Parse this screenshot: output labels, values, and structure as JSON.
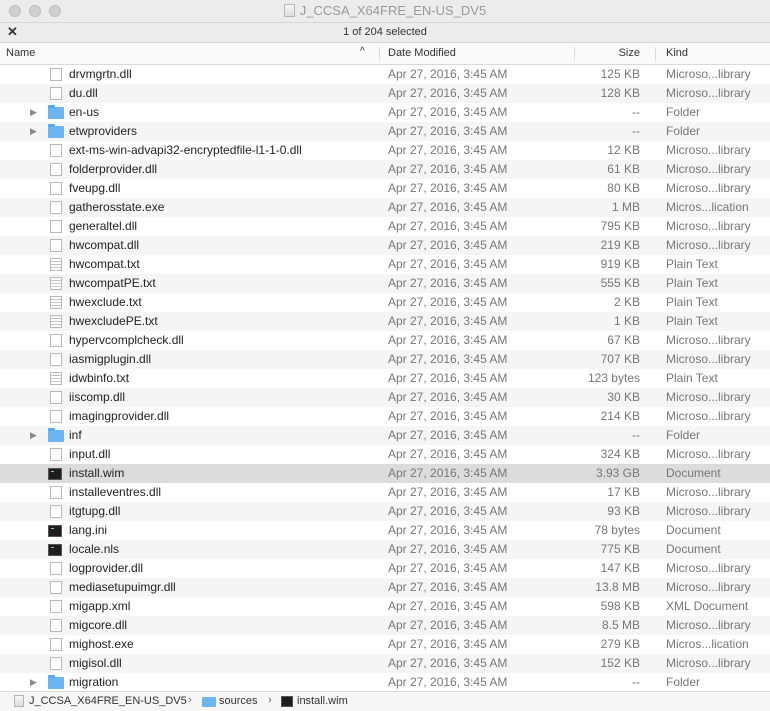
{
  "window": {
    "title": "J_CCSA_X64FRE_EN-US_DV5",
    "status": "1 of 204 selected"
  },
  "columns": {
    "name": "Name",
    "date": "Date Modified",
    "size": "Size",
    "kind": "Kind",
    "sort_indicator": "^"
  },
  "files": [
    {
      "name": "drvmgrtn.dll",
      "date": "Apr 27, 2016, 3:45 AM",
      "size": "125 KB",
      "kind": "Microso...library",
      "icon": "file-icon"
    },
    {
      "name": "du.dll",
      "date": "Apr 27, 2016, 3:45 AM",
      "size": "128 KB",
      "kind": "Microso...library",
      "icon": "file-icon"
    },
    {
      "name": "en-us",
      "date": "Apr 27, 2016, 3:45 AM",
      "size": "--",
      "kind": "Folder",
      "icon": "folder-icon"
    },
    {
      "name": "etwproviders",
      "date": "Apr 27, 2016, 3:45 AM",
      "size": "--",
      "kind": "Folder",
      "icon": "folder-icon"
    },
    {
      "name": "ext-ms-win-advapi32-encryptedfile-l1-1-0.dll",
      "date": "Apr 27, 2016, 3:45 AM",
      "size": "12 KB",
      "kind": "Microso...library",
      "icon": "file-icon"
    },
    {
      "name": "folderprovider.dll",
      "date": "Apr 27, 2016, 3:45 AM",
      "size": "61 KB",
      "kind": "Microso...library",
      "icon": "file-icon"
    },
    {
      "name": "fveupg.dll",
      "date": "Apr 27, 2016, 3:45 AM",
      "size": "80 KB",
      "kind": "Microso...library",
      "icon": "file-icon"
    },
    {
      "name": "gatherosstate.exe",
      "date": "Apr 27, 2016, 3:45 AM",
      "size": "1 MB",
      "kind": "Micros...lication",
      "icon": "file-icon"
    },
    {
      "name": "generaltel.dll",
      "date": "Apr 27, 2016, 3:45 AM",
      "size": "795 KB",
      "kind": "Microso...library",
      "icon": "file-icon"
    },
    {
      "name": "hwcompat.dll",
      "date": "Apr 27, 2016, 3:45 AM",
      "size": "219 KB",
      "kind": "Microso...library",
      "icon": "file-icon"
    },
    {
      "name": "hwcompat.txt",
      "date": "Apr 27, 2016, 3:45 AM",
      "size": "919 KB",
      "kind": "Plain Text",
      "icon": "text-file-icon"
    },
    {
      "name": "hwcompatPE.txt",
      "date": "Apr 27, 2016, 3:45 AM",
      "size": "555 KB",
      "kind": "Plain Text",
      "icon": "text-file-icon"
    },
    {
      "name": "hwexclude.txt",
      "date": "Apr 27, 2016, 3:45 AM",
      "size": "2 KB",
      "kind": "Plain Text",
      "icon": "text-file-icon"
    },
    {
      "name": "hwexcludePE.txt",
      "date": "Apr 27, 2016, 3:45 AM",
      "size": "1 KB",
      "kind": "Plain Text",
      "icon": "text-file-icon"
    },
    {
      "name": "hypervcomplcheck.dll",
      "date": "Apr 27, 2016, 3:45 AM",
      "size": "67 KB",
      "kind": "Microso...library",
      "icon": "file-icon"
    },
    {
      "name": "iasmigplugin.dll",
      "date": "Apr 27, 2016, 3:45 AM",
      "size": "707 KB",
      "kind": "Microso...library",
      "icon": "file-icon"
    },
    {
      "name": "idwbinfo.txt",
      "date": "Apr 27, 2016, 3:45 AM",
      "size": "123 bytes",
      "kind": "Plain Text",
      "icon": "text-file-icon"
    },
    {
      "name": "iiscomp.dll",
      "date": "Apr 27, 2016, 3:45 AM",
      "size": "30 KB",
      "kind": "Microso...library",
      "icon": "file-icon"
    },
    {
      "name": "imagingprovider.dll",
      "date": "Apr 27, 2016, 3:45 AM",
      "size": "214 KB",
      "kind": "Microso...library",
      "icon": "file-icon"
    },
    {
      "name": "inf",
      "date": "Apr 27, 2016, 3:45 AM",
      "size": "--",
      "kind": "Folder",
      "icon": "folder-icon"
    },
    {
      "name": "input.dll",
      "date": "Apr 27, 2016, 3:45 AM",
      "size": "324 KB",
      "kind": "Microso...library",
      "icon": "file-icon"
    },
    {
      "name": "install.wim",
      "date": "Apr 27, 2016, 3:45 AM",
      "size": "3.93 GB",
      "kind": "Document",
      "icon": "document-icon",
      "selected": true
    },
    {
      "name": "installeventres.dll",
      "date": "Apr 27, 2016, 3:45 AM",
      "size": "17 KB",
      "kind": "Microso...library",
      "icon": "file-icon"
    },
    {
      "name": "itgtupg.dll",
      "date": "Apr 27, 2016, 3:45 AM",
      "size": "93 KB",
      "kind": "Microso...library",
      "icon": "file-icon"
    },
    {
      "name": "lang.ini",
      "date": "Apr 27, 2016, 3:45 AM",
      "size": "78 bytes",
      "kind": "Document",
      "icon": "document-icon"
    },
    {
      "name": "locale.nls",
      "date": "Apr 27, 2016, 3:45 AM",
      "size": "775 KB",
      "kind": "Document",
      "icon": "document-icon"
    },
    {
      "name": "logprovider.dll",
      "date": "Apr 27, 2016, 3:45 AM",
      "size": "147 KB",
      "kind": "Microso...library",
      "icon": "file-icon"
    },
    {
      "name": "mediasetupuimgr.dll",
      "date": "Apr 27, 2016, 3:45 AM",
      "size": "13.8 MB",
      "kind": "Microso...library",
      "icon": "file-icon"
    },
    {
      "name": "migapp.xml",
      "date": "Apr 27, 2016, 3:45 AM",
      "size": "598 KB",
      "kind": "XML Document",
      "icon": "file-icon"
    },
    {
      "name": "migcore.dll",
      "date": "Apr 27, 2016, 3:45 AM",
      "size": "8.5 MB",
      "kind": "Microso...library",
      "icon": "file-icon"
    },
    {
      "name": "mighost.exe",
      "date": "Apr 27, 2016, 3:45 AM",
      "size": "279 KB",
      "kind": "Micros...lication",
      "icon": "file-icon"
    },
    {
      "name": "migisol.dll",
      "date": "Apr 27, 2016, 3:45 AM",
      "size": "152 KB",
      "kind": "Microso...library",
      "icon": "file-icon"
    },
    {
      "name": "migration",
      "date": "Apr 27, 2016, 3:45 AM",
      "size": "--",
      "kind": "Folder",
      "icon": "folder-icon"
    }
  ],
  "pathbar": {
    "items": [
      "J_CCSA_X64FRE_EN-US_DV5",
      "sources",
      "install.wim"
    ],
    "separator": "›"
  }
}
